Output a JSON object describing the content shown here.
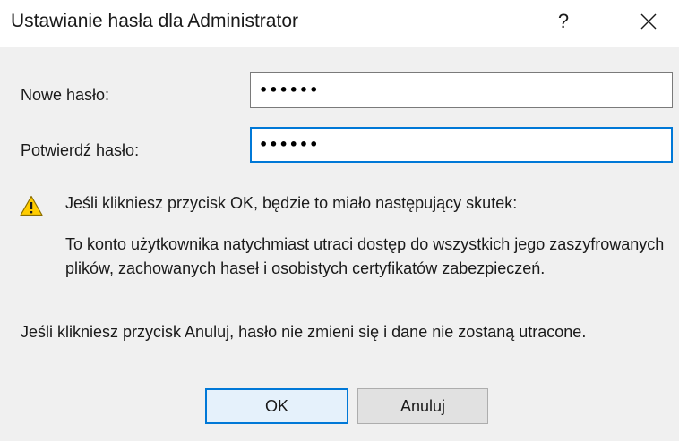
{
  "window": {
    "title": "Ustawianie hasła dla Administrator",
    "help_label": "?",
    "close_icon": "close-icon"
  },
  "form": {
    "new_password": {
      "label": "Nowe hasło:",
      "value": "••••••"
    },
    "confirm_password": {
      "label": "Potwierdź hasło:",
      "value": "••••••",
      "focused": true
    }
  },
  "warning": {
    "icon": "warning-icon",
    "headline": "Jeśli klikniesz przycisk OK, będzie to miało następujący skutek:",
    "body": "To konto użytkownika natychmiast utraci dostęp do wszystkich jego zaszyfrowanych plików, zachowanych haseł i osobistych certyfikatów zabezpieczeń.",
    "accent_color": "#ffcc00"
  },
  "cancel_note": "Jeśli klikniesz przycisk Anuluj, hasło nie zmieni się i dane nie zostaną utracone.",
  "buttons": {
    "ok_label": "OK",
    "cancel_label": "Anuluj",
    "default_border_color": "#0078d7"
  }
}
